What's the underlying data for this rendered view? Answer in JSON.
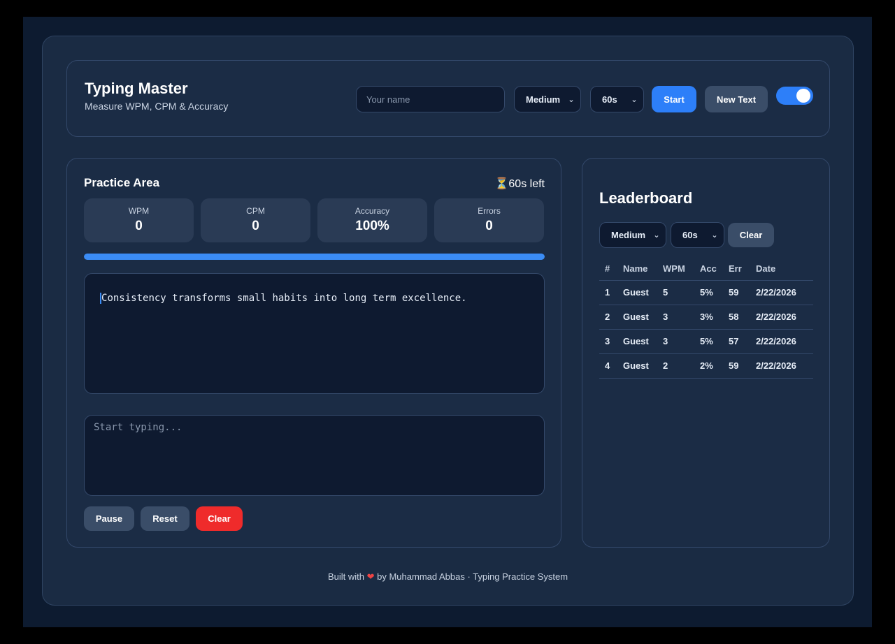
{
  "header": {
    "title": "Typing Master",
    "subtitle": "Measure WPM, CPM & Accuracy",
    "name_placeholder": "Your name",
    "difficulty": "Medium",
    "duration": "60s",
    "start_label": "Start",
    "new_text_label": "New Text",
    "theme_toggle_on": true
  },
  "practice": {
    "title": "Practice Area",
    "timer_icon": "⏳",
    "timer": "60s left",
    "stats": [
      {
        "label": "WPM",
        "value": "0"
      },
      {
        "label": "CPM",
        "value": "0"
      },
      {
        "label": "Accuracy",
        "value": "100%"
      },
      {
        "label": "Errors",
        "value": "0"
      }
    ],
    "progress_percent": 100,
    "text_first_char": "C",
    "text_rest": "onsistency transforms small habits into long term excellence.",
    "input_placeholder": "Start typing...",
    "pause_label": "Pause",
    "reset_label": "Reset",
    "clear_label": "Clear"
  },
  "leaderboard": {
    "title": "Leaderboard",
    "difficulty": "Medium",
    "duration": "60s",
    "clear_label": "Clear",
    "columns": [
      "#",
      "Name",
      "WPM",
      "Acc",
      "Err",
      "Date"
    ],
    "rows": [
      [
        "1",
        "Guest",
        "5",
        "5%",
        "59",
        "2/22/2026"
      ],
      [
        "2",
        "Guest",
        "3",
        "3%",
        "58",
        "2/22/2026"
      ],
      [
        "3",
        "Guest",
        "3",
        "5%",
        "57",
        "2/22/2026"
      ],
      [
        "4",
        "Guest",
        "2",
        "2%",
        "59",
        "2/22/2026"
      ]
    ]
  },
  "footer": {
    "prefix": "Built with",
    "heart": "❤",
    "suffix": "by Muhammad Abbas · Typing Practice System"
  },
  "colors": {
    "accent": "#2d7ff9",
    "danger": "#ef2b2b",
    "panel": "#1b2c45",
    "background": "#0d1b30"
  }
}
